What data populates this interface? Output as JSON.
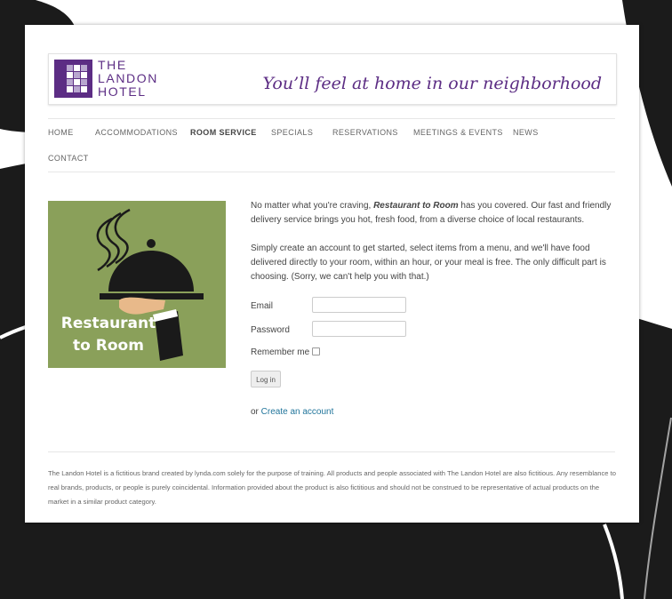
{
  "colors": {
    "brand": "#5c2d84",
    "promo_bg": "#8aa05a",
    "link": "#21759b"
  },
  "logo": {
    "line1": "THE",
    "line2": "LANDON",
    "line3": "HOTEL"
  },
  "header": {
    "tagline": "You’ll feel at home in our neighborhood"
  },
  "nav": {
    "items": [
      {
        "label": "HOME"
      },
      {
        "label": "ACCOMMODATIONS"
      },
      {
        "label": "ROOM SERVICE",
        "active": true
      },
      {
        "label": "SPECIALS"
      },
      {
        "label": "RESERVATIONS"
      },
      {
        "label": "MEETINGS & EVENTS"
      },
      {
        "label": "NEWS"
      },
      {
        "label": "CONTACT"
      }
    ]
  },
  "promo": {
    "line1": "Restaurant",
    "line2": "to Room",
    "icon": "cloche-tray-icon"
  },
  "intro": {
    "p1_before": "No matter what you're craving, ",
    "p1_brand": "Restaurant to Room",
    "p1_after": " has you covered. Our fast and friendly delivery service brings you hot, fresh food, from a diverse choice of local restaurants.",
    "p2": "Simply create an account to get started, select items from a menu, and we'll have food delivered directly to your room, within an hour, or your meal is free. The only difficult part is choosing. (Sorry, we can't help you with that.)"
  },
  "form": {
    "email_label": "Email",
    "email_value": "",
    "password_label": "Password",
    "password_value": "",
    "remember_label": "Remember me",
    "remember_checked": false,
    "login_button": "Log in"
  },
  "create_account": {
    "prefix": "or ",
    "link_text": "Create an account"
  },
  "footer": {
    "disclaimer": "The Landon Hotel is a fictitious brand created by lynda.com solely for the purpose of training. All products and people associated with The Landon Hotel are also fictitious. Any resemblance to real brands, products, or people is purely coincidental. Information provided about the product is also fictitious and should not be construed to be representative of actual products on the market in a similar product category."
  }
}
